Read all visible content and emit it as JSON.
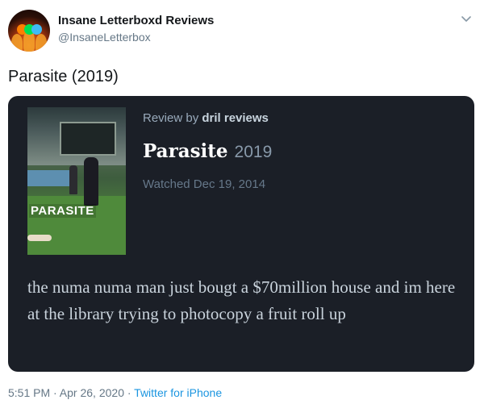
{
  "author": {
    "display_name": "Insane Letterboxd Reviews",
    "handle": "@InsaneLetterbox"
  },
  "tweet": {
    "text": "Parasite (2019)"
  },
  "card": {
    "review_by_prefix": "Review by ",
    "reviewer": "dril reviews",
    "film_title": "Parasite",
    "film_year": "2019",
    "watched": "Watched Dec 19, 2014",
    "poster_title": "PARASITE",
    "review_text": "the numa numa man just bougt a $70million house and im here at the library trying to photocopy a fruit roll up"
  },
  "meta": {
    "timestamp": "5:51 PM · Apr 26, 2020 · ",
    "source": "Twitter for iPhone"
  },
  "colors": {
    "card_bg": "#1b1f27",
    "link": "#1b95e0",
    "secondary": "#657786"
  },
  "icons": {
    "avatar": "letterboxd-dots-avatar",
    "menu": "chevron-down-icon"
  }
}
